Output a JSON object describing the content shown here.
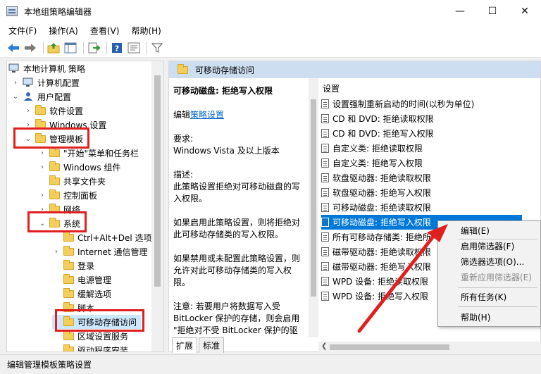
{
  "window": {
    "title": "本地组策略编辑器",
    "minimize": "—",
    "maximize": "☐",
    "close": "✕"
  },
  "menu": [
    "文件(F)",
    "操作(A)",
    "查看(V)",
    "帮助(H)"
  ],
  "tree": {
    "items": [
      {
        "label": "本地计算机 策略",
        "chevron": ""
      },
      {
        "label": "计算机配置",
        "chevron": "›"
      },
      {
        "label": "用户配置",
        "chevron": "⌄"
      },
      {
        "label": "软件设置",
        "chevron": "›"
      },
      {
        "label": "Windows 设置",
        "chevron": "›"
      },
      {
        "label": "管理模板",
        "chevron": "⌄"
      },
      {
        "label": "\"开始\"菜单和任务栏",
        "chevron": "›"
      },
      {
        "label": "Windows 组件",
        "chevron": "›"
      },
      {
        "label": "共享文件夹",
        "chevron": ""
      },
      {
        "label": "控制面板",
        "chevron": "›"
      },
      {
        "label": "网络",
        "chevron": "›"
      },
      {
        "label": "系统",
        "chevron": "⌄"
      },
      {
        "label": "Ctrl+Alt+Del 选项",
        "chevron": ""
      },
      {
        "label": "Internet 通信管理",
        "chevron": "›"
      },
      {
        "label": "登录",
        "chevron": ""
      },
      {
        "label": "电源管理",
        "chevron": ""
      },
      {
        "label": "缓解选项",
        "chevron": ""
      },
      {
        "label": "脚本",
        "chevron": ""
      },
      {
        "label": "可移动存储访问",
        "chevron": ""
      },
      {
        "label": "区域设置服务",
        "chevron": ""
      },
      {
        "label": "驱动程序安装",
        "chevron": ""
      }
    ]
  },
  "details": {
    "header": "可移动存储访问",
    "policy_title": "可移动磁盘: 拒绝写入权限",
    "edit_prefix": "编辑",
    "edit_link": "策略设置",
    "req_label": "要求:",
    "req_value": "Windows Vista 及以上版本",
    "desc_label": "描述:",
    "desc_text": "此策略设置拒绝对可移动磁盘的写入权限。",
    "enabled_text": "如果启用此策略设置，则将拒绝对此可移动存储类的写入权限。",
    "disabled_text": "如果禁用或未配置此策略设置，则允许对此可移动存储类的写入权限。",
    "note_text": "注意: 若要用户将数据写入受 BitLocker 保护的存储，则会启用 \"拒绝对不受 BitLocker 保护的驱"
  },
  "settings": {
    "column": "设置",
    "rows": [
      "设置强制重新启动的时间(以秒为单位)",
      "CD 和 DVD: 拒绝读取权限",
      "CD 和 DVD: 拒绝写入权限",
      "自定义类: 拒绝读取权限",
      "自定义类: 拒绝写入权限",
      "软盘驱动器: 拒绝读取权限",
      "软盘驱动器: 拒绝写入权限",
      "可移动磁盘: 拒绝读取权限",
      "可移动磁盘: 拒绝写入权限",
      "所有可移动存储类: 拒绝所",
      "磁带驱动器: 拒绝读取权限",
      "磁带驱动器: 拒绝写入权限",
      "WPD 设备: 拒绝读取权限",
      "WPD 设备: 拒绝写入权限"
    ],
    "selected_index": 8
  },
  "tabs": [
    "扩展",
    "标准"
  ],
  "context_menu": {
    "edit": "编辑(E)",
    "enable_filter": "启用筛选器(F)",
    "filter_options": "筛选器选项(O)...",
    "reapply_filter": "重新应用筛选器(E)",
    "all_tasks": "所有任务(K)",
    "help": "帮助(H)"
  },
  "status": "编辑管理模板策略设置",
  "colors": {
    "highlight": "#0078d7",
    "annotation": "#e02020",
    "header_bg": "#ccdef0"
  }
}
